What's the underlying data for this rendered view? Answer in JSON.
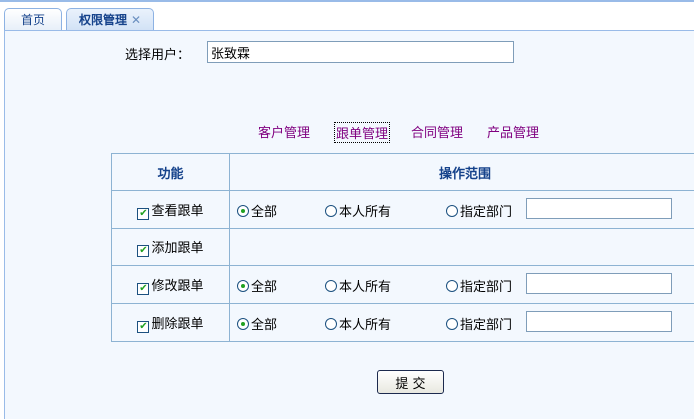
{
  "tabs": [
    {
      "label": "首页"
    },
    {
      "label": "权限管理",
      "close": "✕"
    }
  ],
  "user": {
    "label": "选择用户：",
    "value": "张致霖"
  },
  "modules": [
    "客户管理",
    "跟单管理",
    "合同管理",
    "产品管理"
  ],
  "active_module": "跟单管理",
  "table": {
    "headers": [
      "功能",
      "操作范围"
    ],
    "rows": [
      {
        "func": "查看跟单",
        "checked": true,
        "has_scope": true,
        "scope": "全部"
      },
      {
        "func": "添加跟单",
        "checked": true,
        "has_scope": false
      },
      {
        "func": "修改跟单",
        "checked": true,
        "has_scope": true,
        "scope": "全部"
      },
      {
        "func": "删除跟单",
        "checked": true,
        "has_scope": true,
        "scope": "全部"
      }
    ],
    "scope_options": [
      "全部",
      "本人所有",
      "指定部门"
    ]
  },
  "submit_label": "提 交"
}
